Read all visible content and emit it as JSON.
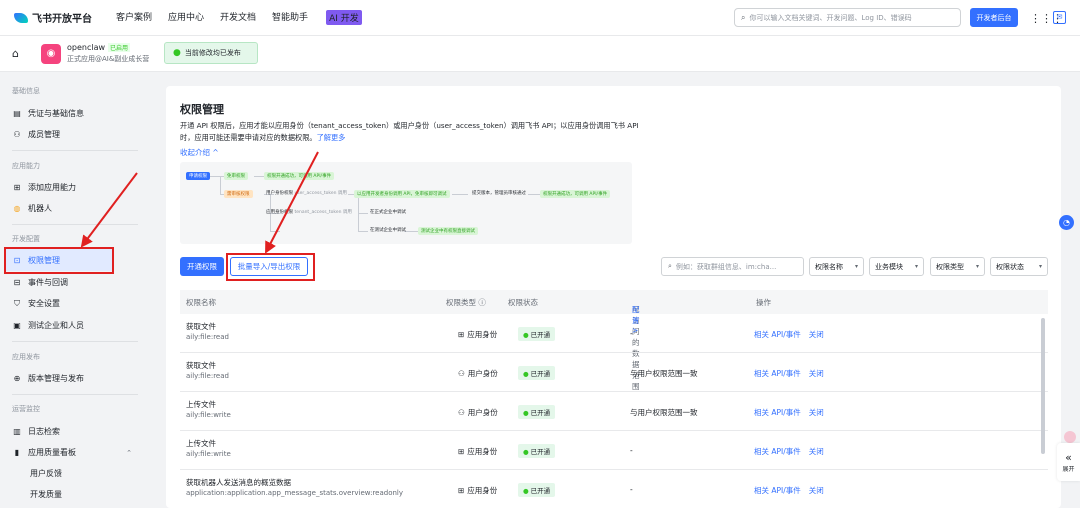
{
  "topbar": {
    "brand": "飞书开放平台",
    "nav": [
      "客户案例",
      "应用中心",
      "开发文档",
      "智能助手"
    ],
    "ai_badge": "AI 开发",
    "search_placeholder": "你可以输入文档关键词、开发问题、Log ID、错误码",
    "dev_console": "开发者后台"
  },
  "app": {
    "name": "openclaw",
    "status": "已启用",
    "desc": "正式应用@AI&副业成长营",
    "publish_banner": "当前修改均已发布"
  },
  "sidebar": {
    "groups": [
      {
        "title": "基础信息",
        "items": [
          "凭证与基础信息",
          "成员管理"
        ]
      },
      {
        "title": "应用能力",
        "items": [
          "添加应用能力",
          "机器人"
        ]
      },
      {
        "title": "开发配置",
        "items": [
          "权限管理",
          "事件与回调",
          "安全设置",
          "测试企业和人员"
        ]
      },
      {
        "title": "应用发布",
        "items": [
          "版本管理与发布"
        ]
      },
      {
        "title": "运营监控",
        "items": [
          "日志检索",
          "应用质量看板"
        ]
      }
    ],
    "subitems": [
      "用户反馈",
      "开发质量"
    ]
  },
  "main": {
    "title": "权限管理",
    "intro": "开通 API 权限后，应用才能以应用身份（tenant_access_token）或用户身份（user_access_token）调用飞书 API；以应用身份调用飞书 API 时，应用可能还需要申请对应的数据权限。",
    "learn_more": "了解更多",
    "collapse": "收起介绍 ^",
    "diagram": {
      "apply": "申请权限",
      "no_review": "免审权限",
      "review": "需审核权限",
      "ok_call": "权限开通成功，可调用 API/事件",
      "user_perm": "用户身份权限",
      "user_token": "user_access_token 调用",
      "auth_user": "以应用开发者身份调用 API，免审核即可调试",
      "submit": "提交版本，管理员审核通过",
      "app_perm": "应用身份权限",
      "tenant_token": "tenant_access_token 调用",
      "in_tenant": "在正式企业中调试",
      "in_test": "在测试企业中调试",
      "test_ok": "测试企业中有权限直接调试"
    },
    "btn_open": "开通权限",
    "btn_batch": "批量导入/导出权限",
    "filter_placeholder": "例如：获取群组信息、im:cha...",
    "filters": [
      "权限名称",
      "业务模块",
      "权限类型",
      "权限状态"
    ],
    "columns": [
      "权限名称",
      "权限类型 ⓘ",
      "权限状态",
      "可访问的数据范围",
      "配置 >",
      "操作"
    ],
    "rows": [
      {
        "name": "获取文件",
        "code": "aily:file:read",
        "type": "应用身份",
        "status": "已开通",
        "scope": "-",
        "actions": [
          "相关 API/事件",
          "关闭"
        ]
      },
      {
        "name": "获取文件",
        "code": "aily:file:read",
        "type": "用户身份",
        "status": "已开通",
        "scope": "与用户权限范围一致",
        "actions": [
          "相关 API/事件",
          "关闭"
        ]
      },
      {
        "name": "上传文件",
        "code": "aily:file:write",
        "type": "用户身份",
        "status": "已开通",
        "scope": "与用户权限范围一致",
        "actions": [
          "相关 API/事件",
          "关闭"
        ]
      },
      {
        "name": "上传文件",
        "code": "aily:file:write",
        "type": "应用身份",
        "status": "已开通",
        "scope": "-",
        "actions": [
          "相关 API/事件",
          "关闭"
        ]
      },
      {
        "name": "获取机器人发送消息的概览数据",
        "code": "application:application.app_message_stats.overview:readonly",
        "type": "应用身份",
        "status": "已开通",
        "scope": "-",
        "actions": [
          "相关 API/事件",
          "关闭"
        ]
      }
    ]
  },
  "float": {
    "unfold": "展开"
  },
  "colors": {
    "primary": "#3370ff",
    "success": "#34c724",
    "annotation": "#e02020"
  }
}
